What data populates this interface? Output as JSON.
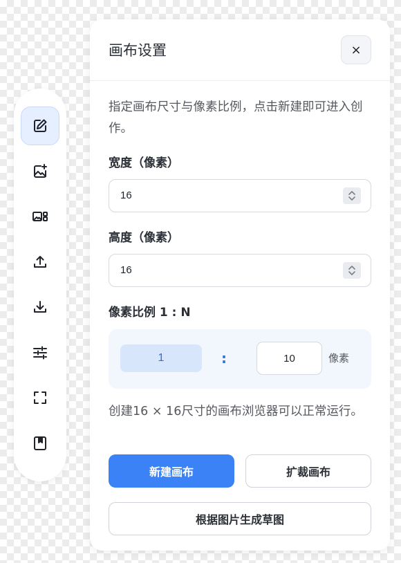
{
  "toolbar": {
    "items": [
      {
        "name": "edit",
        "icon": "edit-icon",
        "active": true
      },
      {
        "name": "add-image",
        "icon": "image-add-icon",
        "active": false
      },
      {
        "name": "image-gallery",
        "icon": "image-grid-icon",
        "active": false
      },
      {
        "name": "upload",
        "icon": "upload-icon",
        "active": false
      },
      {
        "name": "download",
        "icon": "download-icon",
        "active": false
      },
      {
        "name": "adjust",
        "icon": "sliders-icon",
        "active": false
      },
      {
        "name": "fullscreen",
        "icon": "fullscreen-icon",
        "active": false
      },
      {
        "name": "bookmark",
        "icon": "bookmark-icon",
        "active": false
      }
    ]
  },
  "panel": {
    "title": "画布设置",
    "close_label": "×",
    "description": "指定画布尺寸与像素比例，点击新建即可进入创作。",
    "width_label": "宽度（像素）",
    "width_value": "16",
    "height_label": "高度（像素）",
    "height_value": "16",
    "ratio_label": "像素比例 1 : N",
    "ratio_left": "1",
    "ratio_colon": ":",
    "ratio_value": "10",
    "ratio_unit": "像素",
    "status_text": "创建16 × 16尺寸的画布浏览器可以正常运行。",
    "new_canvas_label": "新建画布",
    "expand_canvas_label": "扩裁画布",
    "sketch_label": "根据图片生成草图"
  },
  "colors": {
    "accent": "#3b82f6",
    "active_tool_bg": "#e6efff",
    "ratio_box_bg": "#f2f6fd"
  }
}
